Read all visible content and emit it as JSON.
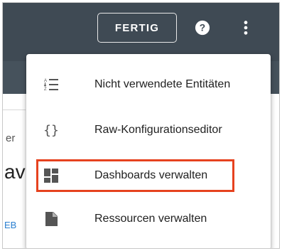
{
  "toolbar": {
    "done_label": "FERTIG",
    "help_icon": "help-circle-icon",
    "more_icon": "more-vertical-icon",
    "header_color": "#3f4a54"
  },
  "background": {
    "fragment_1": "er",
    "fragment_2": "av",
    "fragment_3": "EB"
  },
  "menu": {
    "items": [
      {
        "label": "Nicht verwendete Entitäten",
        "icon": "sort-list-icon"
      },
      {
        "label": "Raw-Konfigurationseditor",
        "icon": "code-braces-icon"
      },
      {
        "label": "Dashboards verwalten",
        "icon": "dashboard-icon",
        "highlighted": true
      },
      {
        "label": "Ressourcen verwalten",
        "icon": "file-document-icon"
      }
    ],
    "highlight_color": "#e6421f"
  }
}
